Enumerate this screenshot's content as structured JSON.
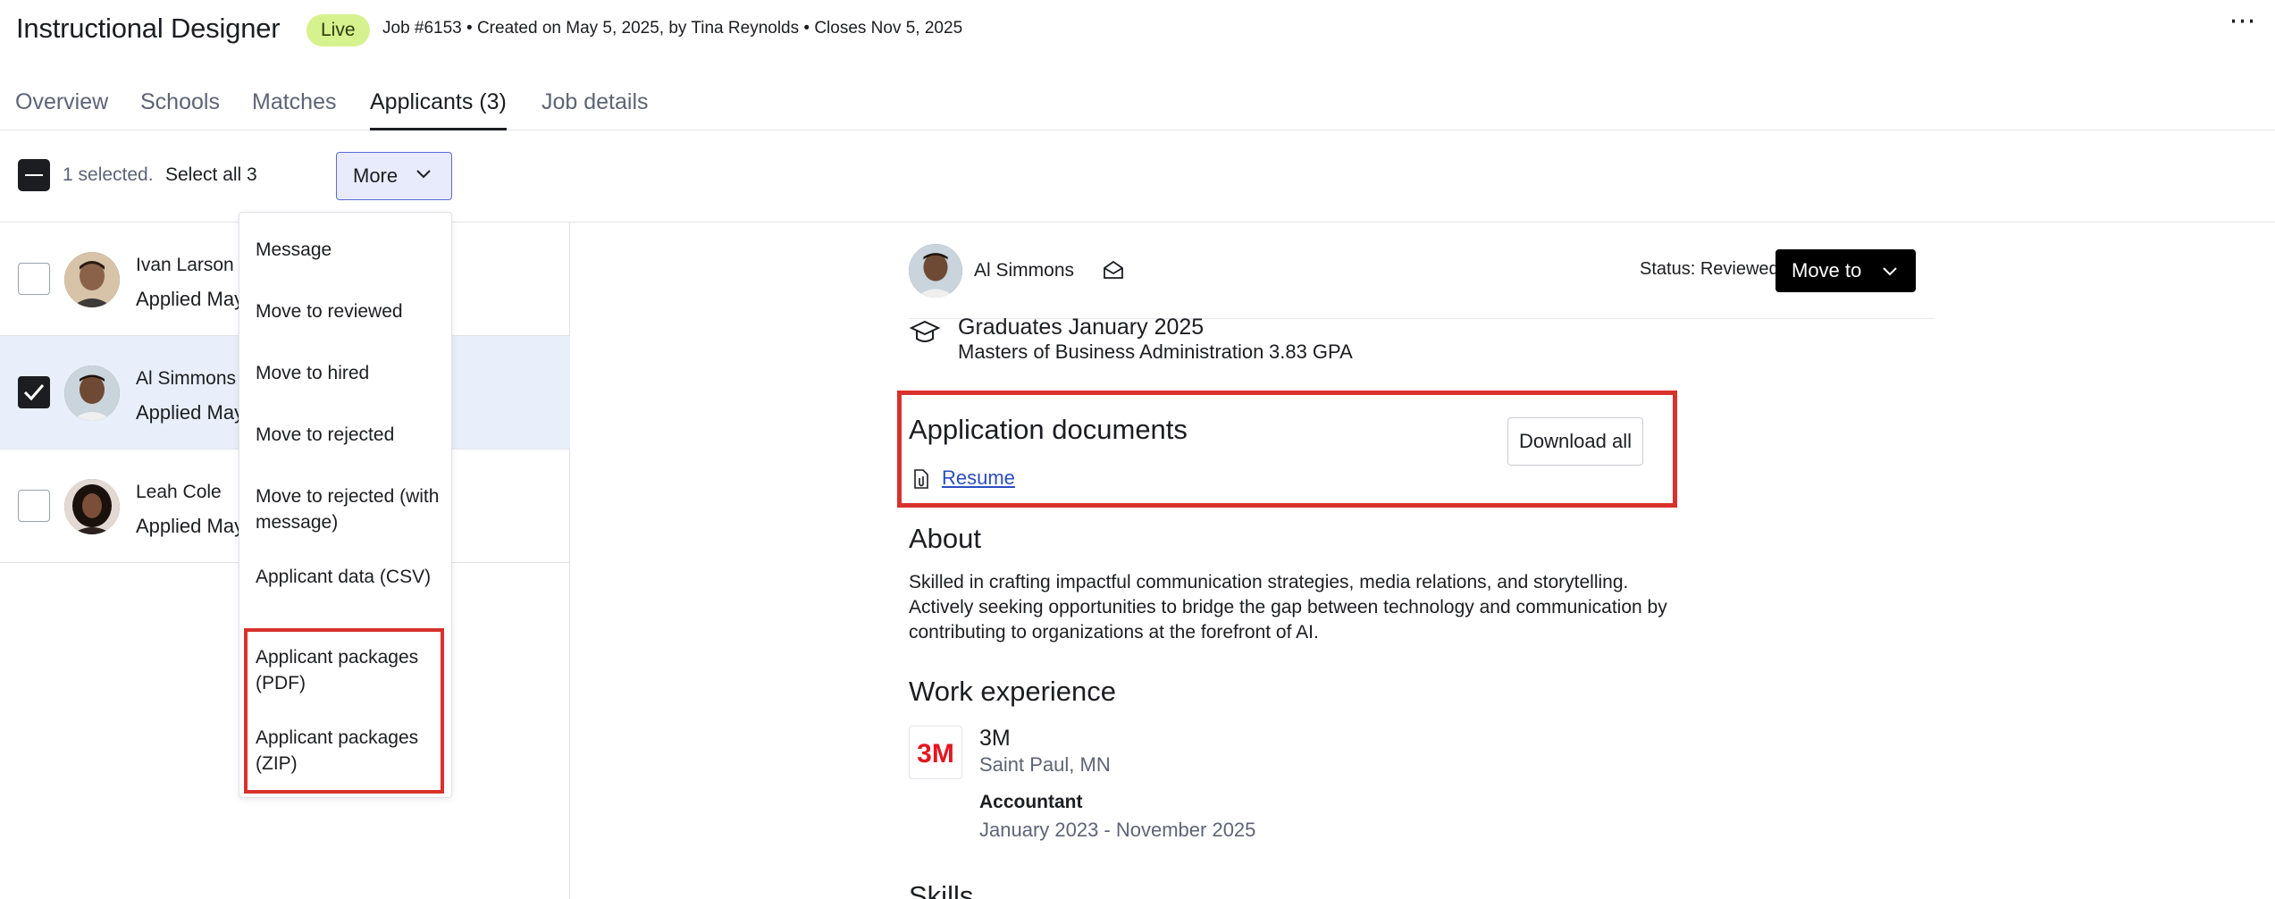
{
  "header": {
    "title": "Instructional Designer",
    "status_badge": "Live",
    "meta": "Job #6153 • Created on May 5, 2025, by Tina Reynolds • Closes Nov 5, 2025",
    "more_options_label": "⋯"
  },
  "tabs": [
    {
      "label": "Overview"
    },
    {
      "label": "Schools"
    },
    {
      "label": "Matches"
    },
    {
      "label": "Applicants (3)",
      "active": true
    },
    {
      "label": "Job details"
    }
  ],
  "toolbar": {
    "selected_text": "1 selected.",
    "select_all": "Select all 3",
    "more_label": "More"
  },
  "applicants": [
    {
      "name": "Ivan Larson",
      "sub": "Applied May",
      "checked": false
    },
    {
      "name": "Al Simmons",
      "sub": "Applied May",
      "checked": true
    },
    {
      "name": "Leah Cole",
      "sub": "Applied May",
      "checked": false
    }
  ],
  "more_menu": {
    "items": [
      {
        "label": "Message"
      },
      {
        "label": "Move to reviewed"
      },
      {
        "label": "Move to hired"
      },
      {
        "label": "Move to rejected"
      },
      {
        "label": "Move to rejected (with message)"
      },
      {
        "label": "Applicant data (CSV)"
      },
      {
        "label": "Applicant packages (PDF)"
      },
      {
        "label": "Applicant packages (ZIP)"
      }
    ]
  },
  "detail": {
    "candidate_name": "Al Simmons",
    "status": "Status: Reviewed",
    "move_to_label": "Move to",
    "education": {
      "title": "Graduates January 2025",
      "degree": "Masters of Business Administration",
      "gpa": "3.83 GPA"
    },
    "documents": {
      "title": "Application documents",
      "download_all": "Download all",
      "resume_link": "Resume"
    },
    "about": {
      "title": "About",
      "text": "Skilled in crafting impactful communication strategies, media relations, and storytelling. Actively seeking opportunities to bridge the gap between technology and communication by contributing to organizations at the forefront of AI."
    },
    "work": {
      "title": "Work experience",
      "company_logo_text": "3M",
      "company": "3M",
      "location": "Saint Paul, MN",
      "role": "Accountant",
      "dates": "January 2023 - November 2025"
    },
    "skills_title": "Skills"
  },
  "colors": {
    "live_badge": "#d6f28f",
    "highlight": "#d9312b",
    "selected_row": "#e8effb",
    "link": "#2b4dc2",
    "brand_3m": "#e4161f"
  }
}
